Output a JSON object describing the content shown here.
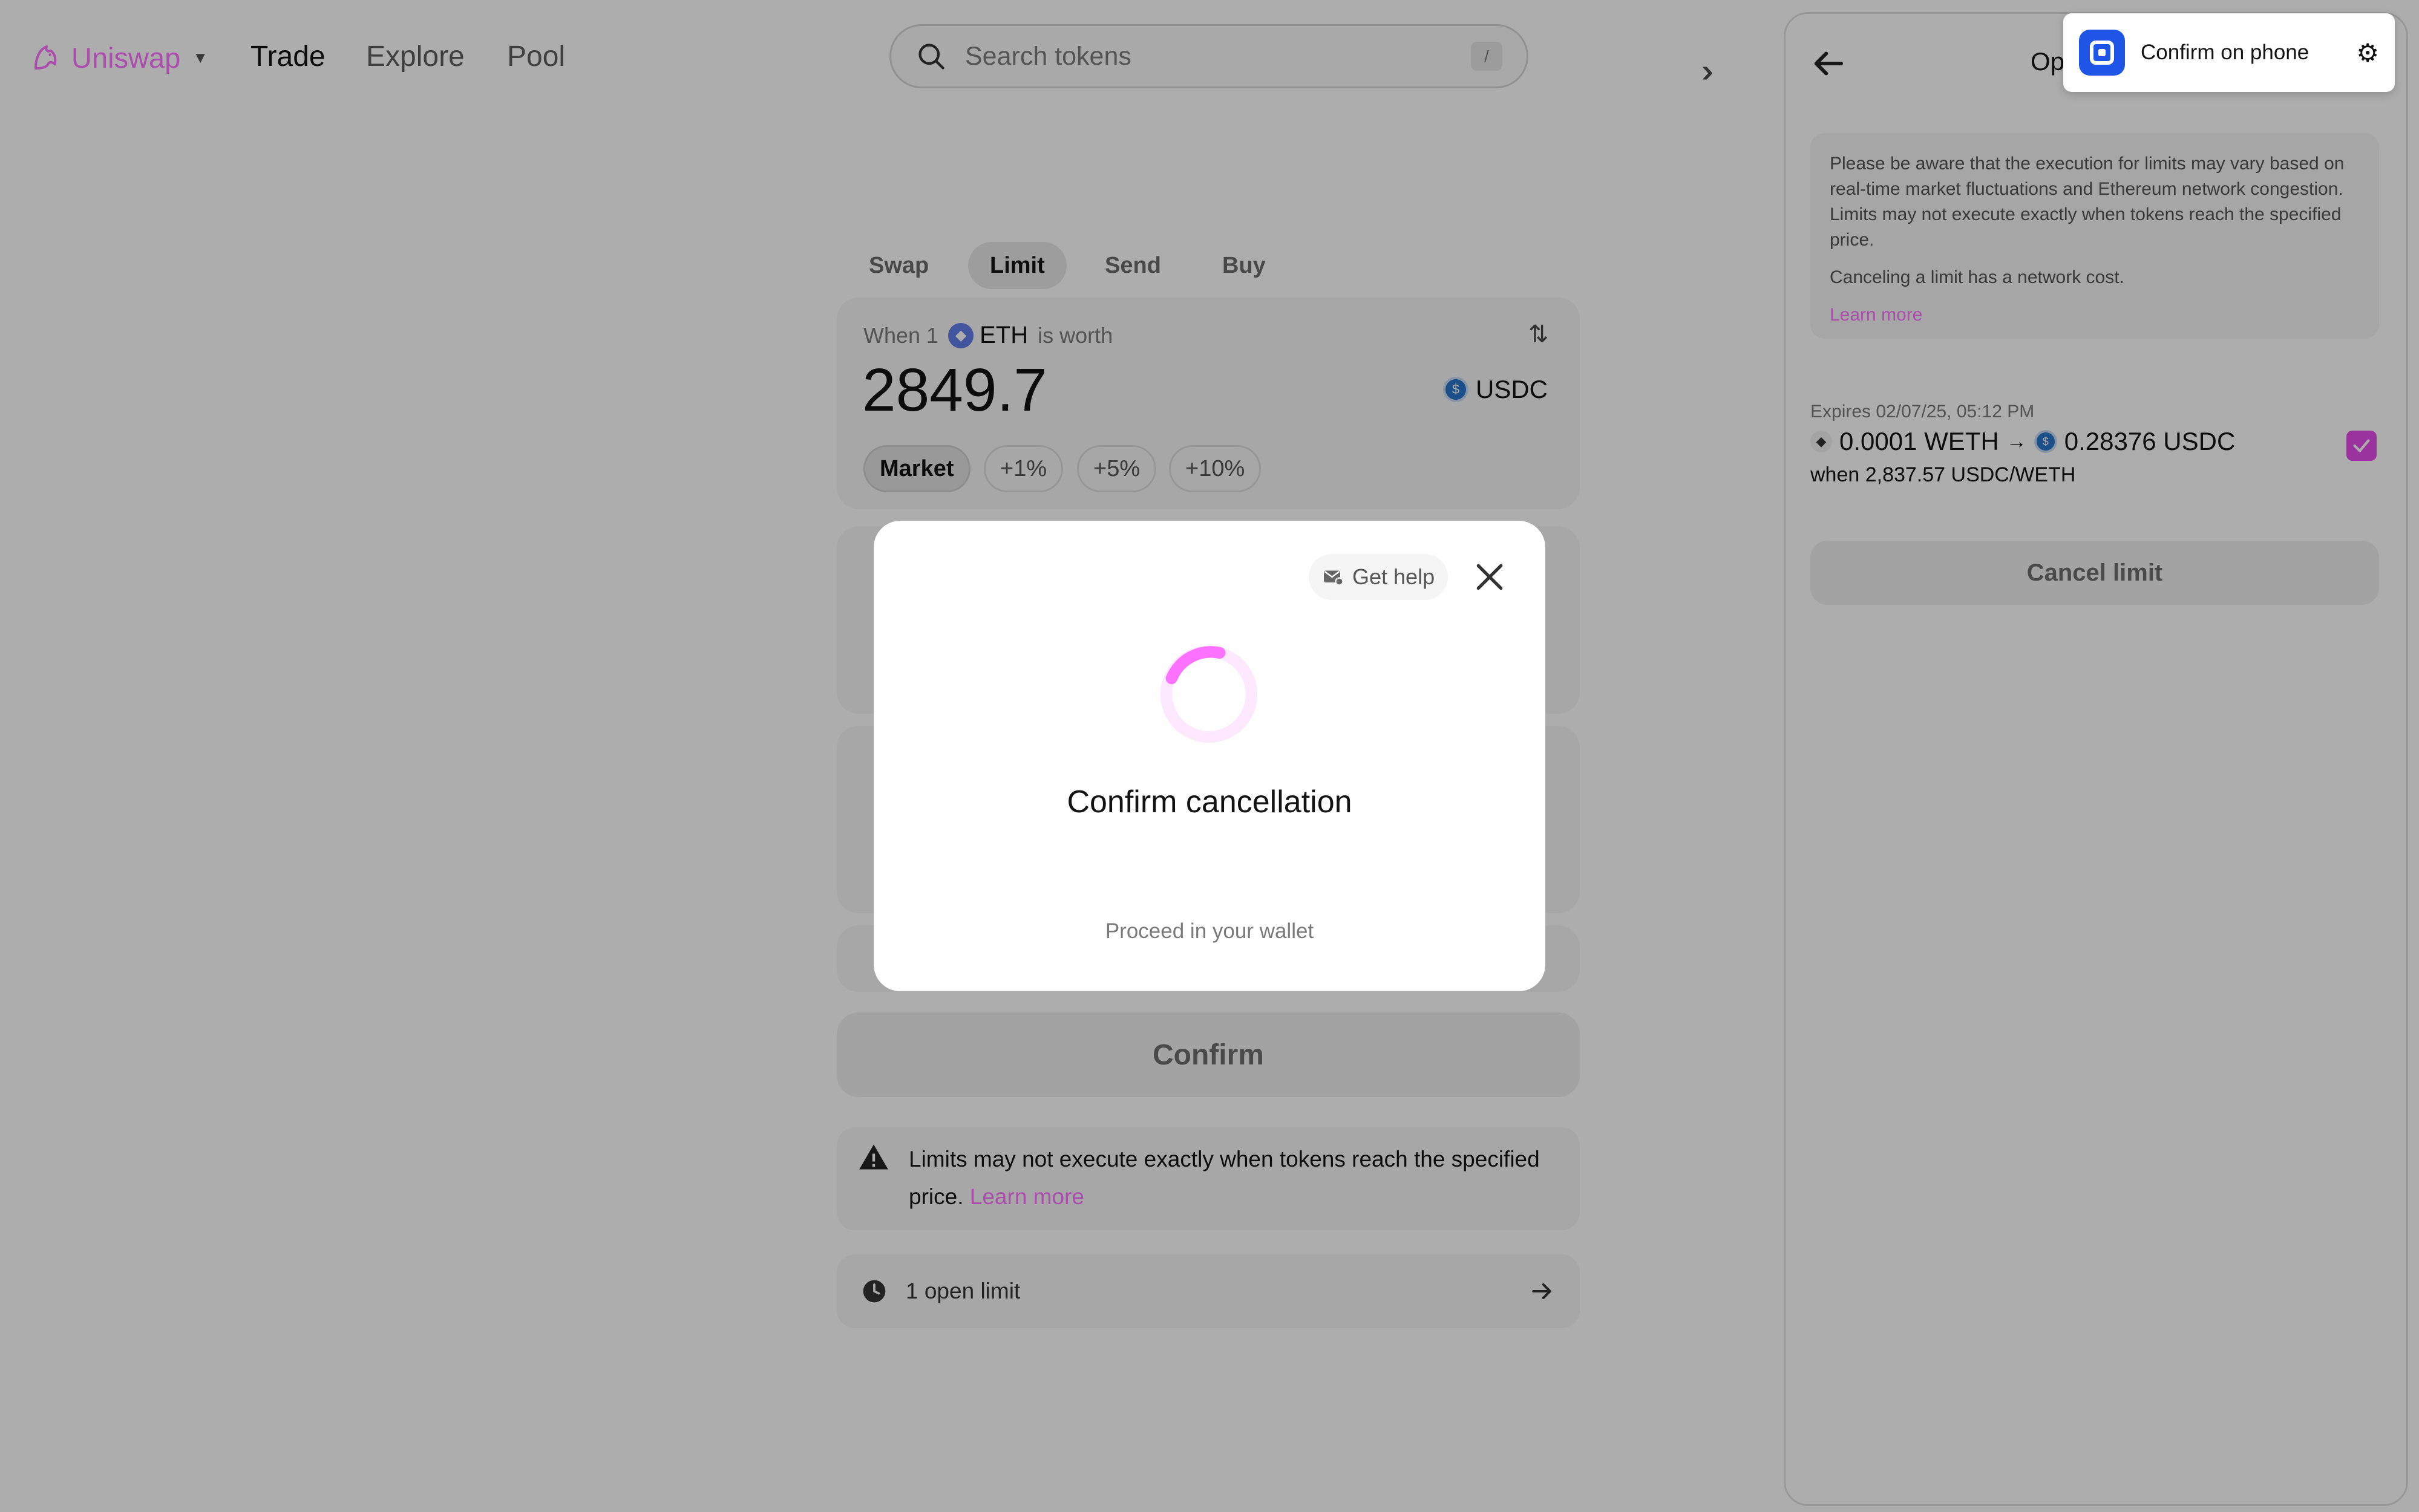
{
  "nav": {
    "brand": "Uniswap",
    "items": [
      {
        "label": "Trade"
      },
      {
        "label": "Explore"
      },
      {
        "label": "Pool"
      }
    ],
    "search_placeholder": "Search tokens",
    "search_shortcut": "/"
  },
  "trade": {
    "tabs": [
      {
        "label": "Swap"
      },
      {
        "label": "Limit"
      },
      {
        "label": "Send"
      },
      {
        "label": "Buy"
      }
    ],
    "when_prefix": "When 1",
    "base_token": "ETH",
    "is_worth": "is worth",
    "price": "2849.7",
    "quote_token": "USDC",
    "chips": [
      {
        "label": "Market"
      },
      {
        "label": "+1%"
      },
      {
        "label": "+5%"
      },
      {
        "label": "+10%"
      }
    ],
    "confirm_label": "Confirm",
    "warning_text": "Limits may not execute exactly when tokens reach the specified price.",
    "warning_link": "Learn more",
    "open_limits": "1 open limit"
  },
  "side_panel": {
    "title": "Op",
    "notice_p1": "Please be aware that the execution for limits may vary based on real-time market fluctuations and Ethereum network congestion. Limits may not execute exactly when tokens reach the specified price.",
    "notice_p2": "Canceling a limit has a network cost.",
    "notice_link": "Learn more",
    "order": {
      "expires": "Expires 02/07/25, 05:12 PM",
      "from_amount": "0.0001 WETH",
      "to_amount": "0.28376 USDC",
      "when": "when 2,837.57 USDC/WETH",
      "selected": true
    },
    "cancel_label": "Cancel limit"
  },
  "toast": {
    "text": "Confirm on phone"
  },
  "modal": {
    "help_label": "Get help",
    "title": "Confirm cancellation",
    "subtitle": "Proceed in your wallet"
  },
  "colors": {
    "accent": "#fc72ff",
    "checkbox": "#e34ce8",
    "toast_icon": "#1f55e6"
  }
}
